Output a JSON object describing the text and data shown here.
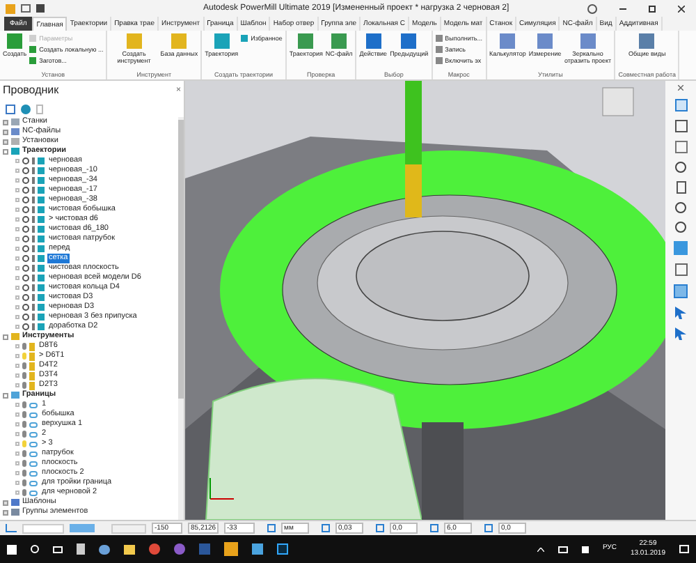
{
  "window": {
    "title": "Autodesk PowerMill Ultimate 2019   [Измененный проект * нагрузка 2 черновая 2]"
  },
  "tabs": [
    {
      "label": "Файл",
      "selected": false,
      "kind": "file"
    },
    {
      "label": "Главная",
      "selected": true,
      "kind": "tab"
    },
    {
      "label": "Траектории",
      "selected": false,
      "kind": "tab"
    },
    {
      "label": "Правка трае",
      "selected": false,
      "kind": "tab"
    },
    {
      "label": "Инструмент",
      "selected": false,
      "kind": "tab"
    },
    {
      "label": "Граница",
      "selected": false,
      "kind": "tab"
    },
    {
      "label": "Шаблон",
      "selected": false,
      "kind": "tab"
    },
    {
      "label": "Набор отвер",
      "selected": false,
      "kind": "tab"
    },
    {
      "label": "Группа эле",
      "selected": false,
      "kind": "tab"
    },
    {
      "label": "Локальная С",
      "selected": false,
      "kind": "tab"
    },
    {
      "label": "Модель",
      "selected": false,
      "kind": "tab"
    },
    {
      "label": "Модель мат",
      "selected": false,
      "kind": "tab"
    },
    {
      "label": "Станок",
      "selected": false,
      "kind": "tab"
    },
    {
      "label": "Симуляция",
      "selected": false,
      "kind": "tab"
    },
    {
      "label": "NC-файл",
      "selected": false,
      "kind": "tab"
    },
    {
      "label": "Вид",
      "selected": false,
      "kind": "tab"
    },
    {
      "label": "Аддитивная",
      "selected": false,
      "kind": "tab"
    }
  ],
  "ribbon": [
    {
      "label": "Установ",
      "items": [
        {
          "label": "Создать",
          "kind": "large"
        },
        {
          "label": "Параметры",
          "kind": "small",
          "disabled": true
        },
        {
          "label": "Создать локальную ...",
          "kind": "small",
          "disabled": false
        },
        {
          "label": "Заготов...",
          "kind": "small",
          "disabled": false
        }
      ]
    },
    {
      "label": "Инструмент",
      "items": [
        {
          "label": "Создать инструмент",
          "kind": "large"
        },
        {
          "label": "База данных",
          "kind": "large"
        }
      ]
    },
    {
      "label": "Создать траектории",
      "items": [
        {
          "label": "Траектория",
          "kind": "large"
        },
        {
          "label": "Избранное",
          "kind": "small",
          "disabled": false
        }
      ]
    },
    {
      "label": "Проверка",
      "items": [
        {
          "label": "Траектория",
          "kind": "large"
        },
        {
          "label": "NC-файл",
          "kind": "large"
        }
      ]
    },
    {
      "label": "Выбор",
      "items": [
        {
          "label": "Действие",
          "kind": "large"
        },
        {
          "label": "Предыдущий",
          "kind": "large"
        }
      ]
    },
    {
      "label": "Макрос",
      "items": [
        {
          "label": "Выполнить...",
          "kind": "small",
          "disabled": false
        },
        {
          "label": "Запись",
          "kind": "small",
          "disabled": false
        },
        {
          "label": "Включить эх",
          "kind": "small",
          "disabled": false
        }
      ]
    },
    {
      "label": "Утилиты",
      "items": [
        {
          "label": "Калькулятор",
          "kind": "large"
        },
        {
          "label": "Измерение",
          "kind": "large"
        },
        {
          "label": "Зеркально отразить проект",
          "kind": "large"
        }
      ]
    },
    {
      "label": "Совместная работа",
      "items": [
        {
          "label": "Общие виды",
          "kind": "large"
        }
      ]
    }
  ],
  "explorer": {
    "title": "Проводник",
    "close": "×",
    "tree": [
      {
        "label": "Станки",
        "kind": "machine",
        "expanded": false
      },
      {
        "label": "NC-файлы",
        "kind": "ncfile",
        "expanded": false
      },
      {
        "label": "Установки",
        "kind": "setup",
        "expanded": false
      },
      {
        "label": "Траектории",
        "kind": "toolpaths",
        "expanded": true,
        "children": [
          {
            "label": "черновая",
            "selected": false
          },
          {
            "label": "черновая_-10",
            "selected": false
          },
          {
            "label": "черновая_-34",
            "selected": false
          },
          {
            "label": "черновая_-17",
            "selected": false
          },
          {
            "label": "черновая_-38",
            "selected": false
          },
          {
            "label": "чистовая бобышка",
            "selected": false
          },
          {
            "label": "> чистовая d6",
            "selected": false
          },
          {
            "label": "чистовая d6_180",
            "selected": false
          },
          {
            "label": "чистовая патрубок",
            "selected": false
          },
          {
            "label": "перед",
            "selected": false
          },
          {
            "label": "сетка",
            "selected": true
          },
          {
            "label": "чистовая плоскость",
            "selected": false
          },
          {
            "label": "черновая всей модели D6",
            "selected": false
          },
          {
            "label": "чистовая кольца D4",
            "selected": false
          },
          {
            "label": "чистовая D3",
            "selected": false
          },
          {
            "label": "черновая D3",
            "selected": false
          },
          {
            "label": "черновая 3 без припуска",
            "selected": false
          },
          {
            "label": "доработка D2",
            "selected": false
          }
        ]
      },
      {
        "label": "Инструменты",
        "kind": "tools",
        "expanded": true,
        "children": [
          {
            "label": "D8T6",
            "selected": false
          },
          {
            "label": "> D6T1",
            "selected": true
          },
          {
            "label": "D4T2",
            "selected": false
          },
          {
            "label": "D3T4",
            "selected": false
          },
          {
            "label": "D2T3",
            "selected": false
          }
        ]
      },
      {
        "label": "Границы",
        "kind": "boundaries",
        "expanded": true,
        "children": [
          {
            "label": "1",
            "selected": false
          },
          {
            "label": "бобышка",
            "selected": false
          },
          {
            "label": "верхушка 1",
            "selected": false
          },
          {
            "label": "2",
            "selected": false
          },
          {
            "label": "> 3",
            "selected": true
          },
          {
            "label": "патрубок",
            "selected": false
          },
          {
            "label": "плоскость",
            "selected": false
          },
          {
            "label": "плоскость 2",
            "selected": false
          },
          {
            "label": "для тройки граница",
            "selected": false
          },
          {
            "label": "для черновой 2",
            "selected": false
          }
        ]
      },
      {
        "label": "Шаблоны",
        "kind": "templates",
        "expanded": false
      },
      {
        "label": "Группы элементов",
        "kind": "groups",
        "expanded": false
      }
    ]
  },
  "status_bar": {
    "fields": [
      {
        "value": "-150",
        "kind": "coord"
      },
      {
        "value": "85,2126",
        "kind": "coord"
      },
      {
        "value": "-33",
        "kind": "coord"
      },
      {
        "value": "мм",
        "kind": "units"
      },
      {
        "value": "0,03",
        "kind": "tolerance"
      },
      {
        "value": "0,0",
        "kind": "stock"
      },
      {
        "value": "6,0",
        "kind": "diameter"
      },
      {
        "value": "0,0",
        "kind": "angle"
      }
    ]
  },
  "taskbar": {
    "language": "РУС",
    "time": "22:59",
    "date": "13.01.2019"
  }
}
